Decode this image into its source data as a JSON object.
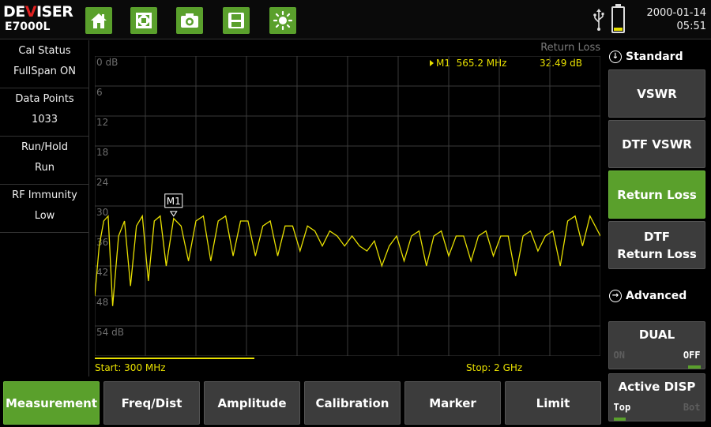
{
  "header": {
    "brand": "DEVISER",
    "model": "E7000L",
    "toolbar": [
      "home-icon",
      "fullscreen-icon",
      "camera-icon",
      "save-icon",
      "brightness-icon"
    ],
    "date": "2000-01-14",
    "time": "05:51",
    "battery_level": 0.15
  },
  "status_panel": [
    {
      "label": "Cal Status",
      "value": "FullSpan ON"
    },
    {
      "label": "Data Points",
      "value": "1033"
    },
    {
      "label": "Run/Hold",
      "value": "Run"
    },
    {
      "label": "RF Immunity",
      "value": "Low"
    }
  ],
  "plot": {
    "title": "Return Loss",
    "marker": {
      "name": "M1",
      "freq": "565.2 MHz",
      "value": "32.49 dB"
    },
    "start": "Start: 300 MHz",
    "stop": "Stop: 2 GHz",
    "y_labels": [
      "0  dB",
      "6",
      "12",
      "18",
      "24",
      "30",
      "36",
      "42",
      "48",
      "54  dB"
    ]
  },
  "chart_data": {
    "type": "line",
    "title": "Return Loss",
    "x_range_mhz": [
      300,
      2000
    ],
    "ylim": [
      0,
      60
    ],
    "y_inverted": true,
    "grid": true,
    "series": [
      {
        "name": "Return Loss",
        "color": "#e8e000",
        "x": [
          300,
          315,
          330,
          345,
          360,
          380,
          400,
          420,
          440,
          460,
          480,
          500,
          520,
          540,
          565,
          590,
          615,
          640,
          665,
          690,
          715,
          740,
          765,
          790,
          815,
          840,
          865,
          890,
          915,
          940,
          965,
          990,
          1015,
          1040,
          1065,
          1090,
          1115,
          1140,
          1165,
          1190,
          1215,
          1240,
          1265,
          1290,
          1315,
          1340,
          1365,
          1390,
          1415,
          1440,
          1465,
          1490,
          1515,
          1540,
          1565,
          1590,
          1615,
          1640,
          1665,
          1690,
          1715,
          1740,
          1765,
          1790,
          1815,
          1840,
          1865,
          1890,
          1915,
          1940,
          1965,
          2000
        ],
        "values": [
          48,
          38,
          33,
          32,
          50,
          36,
          33,
          46,
          34,
          32,
          45,
          33,
          32,
          42,
          32.5,
          34,
          41,
          33,
          32,
          41,
          33,
          32,
          40,
          33,
          33,
          40,
          34,
          33,
          40,
          34,
          34,
          39,
          34,
          35,
          38,
          35,
          36,
          38,
          36,
          38,
          39,
          37,
          42,
          38,
          36,
          41,
          36,
          35,
          42,
          36,
          35,
          40,
          36,
          36,
          41,
          36,
          35,
          40,
          36,
          36,
          44,
          36,
          35,
          39,
          36,
          35,
          42,
          33,
          32,
          38,
          32,
          36
        ]
      }
    ]
  },
  "menu": {
    "standard_label": "Standard",
    "advanced_label": "Advanced",
    "buttons": [
      {
        "label": "VSWR"
      },
      {
        "label": "DTF VSWR"
      },
      {
        "label": "Return Loss"
      },
      {
        "label": "DTF",
        "label2": "Return Loss"
      }
    ],
    "dual": {
      "label": "DUAL",
      "off_label": "ON",
      "on_label": "OFF"
    },
    "active_disp": {
      "label": "Active DISP",
      "top": "Top",
      "bot": "Bot"
    }
  },
  "tabs": [
    "Measurement",
    "Freq/Dist",
    "Amplitude",
    "Calibration",
    "Marker",
    "Limit"
  ],
  "colors": {
    "accent": "#5aa02c",
    "trace": "#e8e000",
    "button": "#3c3c3c"
  }
}
